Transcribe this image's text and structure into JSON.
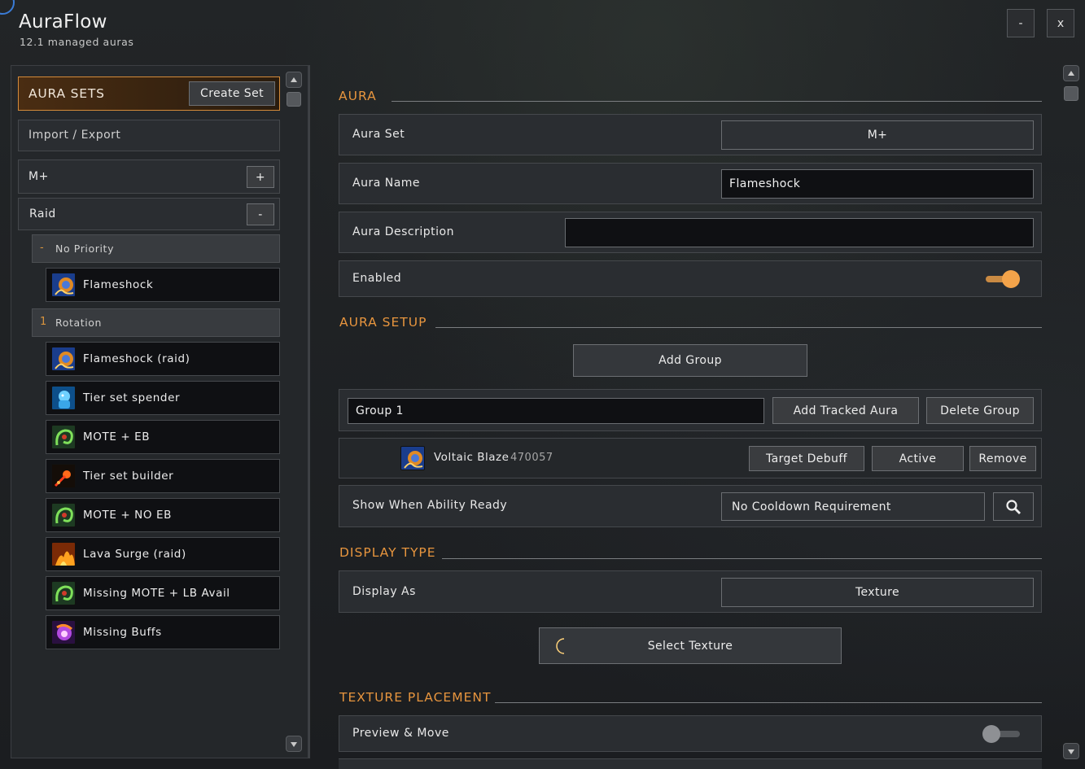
{
  "app": {
    "title": "AuraFlow",
    "subtitle": "12.1 managed auras"
  },
  "window_controls": {
    "minimize": "-",
    "close": "x"
  },
  "sidebar": {
    "header_label": "AURA SETS",
    "create_set_label": "Create Set",
    "import_export_label": "Import / Export",
    "sets": [
      {
        "label": "M+",
        "toggle": "+"
      },
      {
        "label": "Raid",
        "toggle": "-"
      }
    ],
    "groups": [
      {
        "mark": "-",
        "label": "No Priority",
        "auras": [
          {
            "label": "Flameshock",
            "icon": "flameshock-icon"
          }
        ]
      },
      {
        "mark": "1",
        "label": "Rotation",
        "auras": [
          {
            "label": "Flameshock (raid)",
            "icon": "flameshock-icon"
          },
          {
            "label": "Tier set spender",
            "icon": "frost-elemental-icon"
          },
          {
            "label": "MOTE + EB",
            "icon": "nature-swirl-icon"
          },
          {
            "label": "Tier set builder",
            "icon": "fire-bolt-icon"
          },
          {
            "label": "MOTE + NO EB",
            "icon": "nature-swirl-icon"
          },
          {
            "label": "Lava Surge (raid)",
            "icon": "lava-surge-icon"
          },
          {
            "label": "Missing MOTE + LB Avail",
            "icon": "nature-swirl-icon"
          },
          {
            "label": "Missing Buffs",
            "icon": "arcane-buff-icon"
          }
        ]
      }
    ]
  },
  "aura": {
    "section_title": "AURA",
    "aura_set_label": "Aura Set",
    "aura_set_value": "M+",
    "aura_name_label": "Aura Name",
    "aura_name_value": "Flameshock",
    "aura_description_label": "Aura Description",
    "aura_description_value": "",
    "enabled_label": "Enabled",
    "enabled": true
  },
  "aura_setup": {
    "section_title": "AURA SETUP",
    "add_group_label": "Add Group",
    "group_name_value": "Group 1",
    "add_tracked_aura_label": "Add Tracked Aura",
    "delete_group_label": "Delete Group",
    "tracked": {
      "name": "Voltaic Blaze",
      "spell_id": "470057",
      "icon": "voltaic-blaze-icon",
      "target_label": "Target Debuff",
      "state_label": "Active",
      "remove_label": "Remove"
    },
    "show_when_ready_label": "Show When Ability Ready",
    "cooldown_value": "No Cooldown Requirement",
    "search_icon": "search-icon"
  },
  "display_type": {
    "section_title": "DISPLAY TYPE",
    "display_as_label": "Display As",
    "display_as_value": "Texture",
    "select_texture_label": "Select Texture"
  },
  "texture_placement": {
    "section_title": "TEXTURE PLACEMENT",
    "preview_move_label": "Preview & Move",
    "preview_enabled": false
  },
  "colors": {
    "accent": "#e7953e",
    "panel": "#2a2d31",
    "input_bg": "#0f1013"
  }
}
